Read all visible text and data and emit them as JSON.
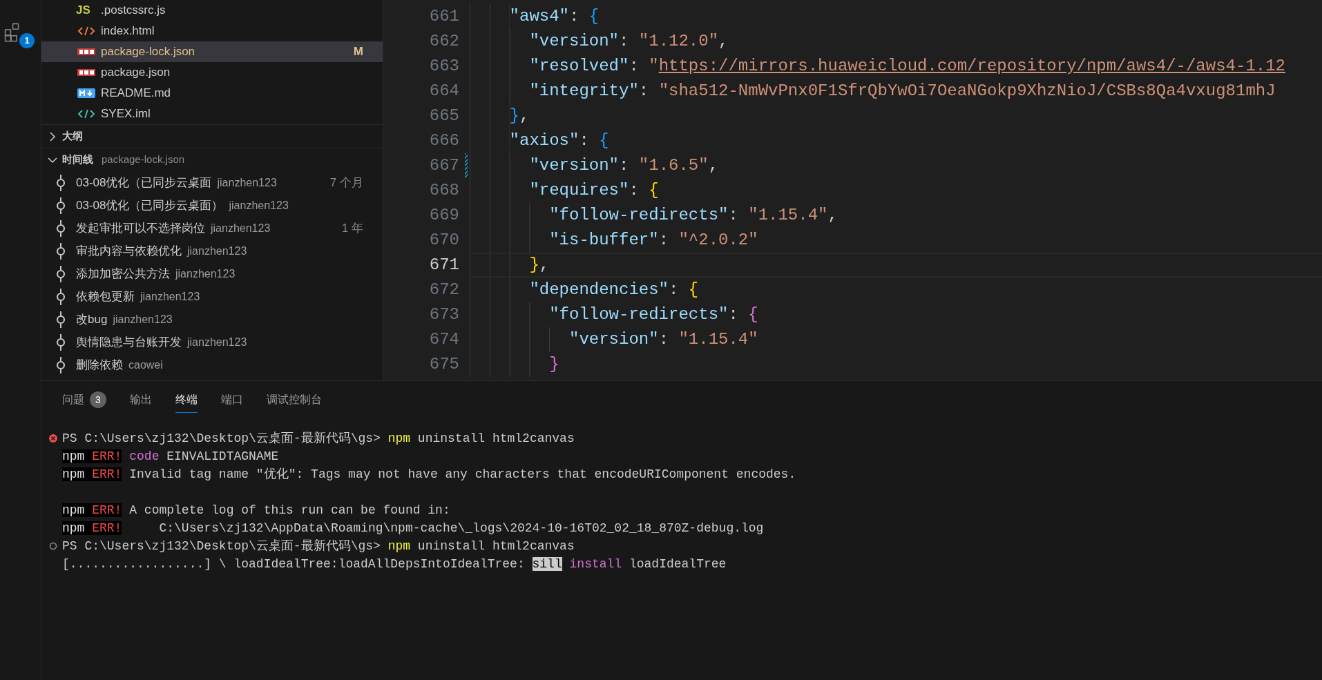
{
  "activity_bar": {
    "extensions_badge": "1"
  },
  "explorer": {
    "files": [
      {
        "name": ".postcssrc.js",
        "kind": "js",
        "icon_text": "JS",
        "selected": false,
        "modified": false
      },
      {
        "name": "index.html",
        "kind": "html",
        "selected": false,
        "modified": false
      },
      {
        "name": "package-lock.json",
        "kind": "npm",
        "selected": true,
        "modified": true,
        "status_letter": "M"
      },
      {
        "name": "package.json",
        "kind": "npm",
        "selected": false,
        "modified": false
      },
      {
        "name": "README.md",
        "kind": "markdown",
        "selected": false,
        "modified": false
      },
      {
        "name": "SYEX.iml",
        "kind": "xml",
        "selected": false,
        "modified": false
      }
    ]
  },
  "outline": {
    "title": "大纲",
    "expanded": false
  },
  "timeline": {
    "title": "时间线",
    "subtitle": "package-lock.json",
    "expanded": true,
    "items": [
      {
        "message": "03-08优化（已同步云桌面",
        "author": "jianzhen123",
        "time": "7 个月"
      },
      {
        "message": "03-08优化（已同步云桌面）",
        "author": "jianzhen123"
      },
      {
        "message": "发起审批可以不选择岗位",
        "author": "jianzhen123",
        "time": "1 年"
      },
      {
        "message": "审批内容与依赖优化",
        "author": "jianzhen123"
      },
      {
        "message": "添加加密公共方法",
        "author": "jianzhen123"
      },
      {
        "message": "依赖包更新",
        "author": "jianzhen123"
      },
      {
        "message": "改bug",
        "author": "jianzhen123"
      },
      {
        "message": "舆情隐患与台账开发",
        "author": "jianzhen123"
      },
      {
        "message": "删除依赖",
        "author": "caowei"
      }
    ]
  },
  "editor": {
    "lines": [
      {
        "number": "661",
        "current": false,
        "modified": false,
        "tokens": [
          {
            "text": "\"aws4\"",
            "kind": "key"
          },
          {
            "text": ": ",
            "kind": "punct"
          },
          {
            "text": "{",
            "kind": "bracket",
            "color": "#179fff"
          }
        ],
        "children": [
          {
            "number": "662",
            "current": false,
            "modified": false,
            "tokens": [
              {
                "text": "\"version\"",
                "kind": "key"
              },
              {
                "text": ": ",
                "kind": "punct"
              },
              {
                "text": "\"1.12.0\"",
                "kind": "string"
              },
              {
                "text": ",",
                "kind": "punct"
              }
            ]
          },
          {
            "number": "663",
            "current": false,
            "modified": false,
            "tokens": [
              {
                "text": "\"resolved\"",
                "kind": "key"
              },
              {
                "text": ": ",
                "kind": "punct"
              },
              {
                "text": "\"",
                "kind": "string"
              },
              {
                "text": "https://mirrors.huaweicloud.com/repository/npm/aws4/-/aws4-1.12",
                "kind": "link"
              }
            ]
          },
          {
            "number": "664",
            "current": false,
            "modified": false,
            "tokens": [
              {
                "text": "\"integrity\"",
                "kind": "key"
              },
              {
                "text": ": ",
                "kind": "punct"
              },
              {
                "text": "\"sha512-NmWvPnx0F1SfrQbYwOi7OeaNGokp9XhzNioJ/CSBs8Qa4vxug81mhJ",
                "kind": "string"
              }
            ]
          }
        ]
      },
      {
        "number": "665",
        "current": false,
        "modified": false,
        "tokens": [
          {
            "text": "}",
            "kind": "bracket",
            "color": "#179fff"
          },
          {
            "text": ",",
            "kind": "punct"
          }
        ]
      },
      {
        "number": "666",
        "current": false,
        "modified": false,
        "tokens": [
          {
            "text": "\"axios\"",
            "kind": "key"
          },
          {
            "text": ": ",
            "kind": "punct"
          },
          {
            "text": "{",
            "kind": "bracket",
            "color": "#179fff"
          }
        ],
        "children": [
          {
            "number": "667",
            "current": false,
            "modified": true,
            "tokens": [
              {
                "text": "\"version\"",
                "kind": "key"
              },
              {
                "text": ": ",
                "kind": "punct"
              },
              {
                "text": "\"1.6.5\"",
                "kind": "string"
              },
              {
                "text": ",",
                "kind": "punct"
              }
            ]
          },
          {
            "number": "668",
            "current": false,
            "modified": false,
            "tokens": [
              {
                "text": "\"requires\"",
                "kind": "key"
              },
              {
                "text": ": ",
                "kind": "punct"
              },
              {
                "text": "{",
                "kind": "bracket",
                "color": "#ffd700"
              }
            ],
            "children": [
              {
                "number": "669",
                "current": false,
                "modified": false,
                "tokens": [
                  {
                    "text": "\"follow-redirects\"",
                    "kind": "key"
                  },
                  {
                    "text": ": ",
                    "kind": "punct"
                  },
                  {
                    "text": "\"1.15.4\"",
                    "kind": "string"
                  },
                  {
                    "text": ",",
                    "kind": "punct"
                  }
                ]
              },
              {
                "number": "670",
                "current": false,
                "modified": false,
                "tokens": [
                  {
                    "text": "\"is-buffer\"",
                    "kind": "key"
                  },
                  {
                    "text": ": ",
                    "kind": "punct"
                  },
                  {
                    "text": "\"^2.0.2\"",
                    "kind": "string"
                  }
                ]
              }
            ]
          },
          {
            "number": "671",
            "current": true,
            "modified": false,
            "tokens": [
              {
                "text": "}",
                "kind": "bracket",
                "color": "#ffd700"
              },
              {
                "text": ",",
                "kind": "punct"
              }
            ]
          },
          {
            "number": "672",
            "current": false,
            "modified": false,
            "tokens": [
              {
                "text": "\"dependencies\"",
                "kind": "key"
              },
              {
                "text": ": ",
                "kind": "punct"
              },
              {
                "text": "{",
                "kind": "bracket",
                "color": "#ffd700"
              }
            ],
            "children": [
              {
                "number": "673",
                "current": false,
                "modified": false,
                "tokens": [
                  {
                    "text": "\"follow-redirects\"",
                    "kind": "key"
                  },
                  {
                    "text": ": ",
                    "kind": "punct"
                  },
                  {
                    "text": "{",
                    "kind": "bracket",
                    "color": "#da70d6"
                  }
                ],
                "children": [
                  {
                    "number": "674",
                    "current": false,
                    "modified": false,
                    "tokens": [
                      {
                        "text": "\"version\"",
                        "kind": "key"
                      },
                      {
                        "text": ": ",
                        "kind": "punct"
                      },
                      {
                        "text": "\"1.15.4\"",
                        "kind": "string"
                      }
                    ]
                  }
                ]
              },
              {
                "number": "675",
                "current": false,
                "modified": false,
                "tokens": [
                  {
                    "text": "}",
                    "kind": "bracket",
                    "color": "#da70d6"
                  }
                ]
              }
            ]
          }
        ]
      }
    ]
  },
  "panel": {
    "tabs": [
      {
        "label": "问题",
        "badge": "3",
        "selected": false
      },
      {
        "label": "输出",
        "selected": false
      },
      {
        "label": "终端",
        "selected": true
      },
      {
        "label": "端口",
        "selected": false
      },
      {
        "label": "调试控制台",
        "selected": false
      }
    ],
    "terminal": {
      "lines": [
        {
          "kind": "failed",
          "tokens": [
            {
              "text": "PS C:\\Users\\zj132\\Desktop\\云桌面-最新代码\\gs> ",
              "kind": "plain"
            },
            {
              "text": "npm",
              "kind": "command"
            },
            {
              "text": " uninstall html2canvas",
              "kind": "plain"
            }
          ]
        },
        {
          "kind": "output",
          "tokens": [
            {
              "text": "npm ",
              "kind": "label"
            },
            {
              "text": "ERR!",
              "kind": "error"
            },
            {
              "text": " code",
              "kind": "keyword"
            },
            {
              "text": " EINVALIDTAGNAME",
              "kind": "plain"
            }
          ]
        },
        {
          "kind": "output",
          "tokens": [
            {
              "text": "npm ",
              "kind": "label"
            },
            {
              "text": "ERR!",
              "kind": "error"
            },
            {
              "text": " Invalid tag name \"优化\": Tags may not have any characters that encodeURIComponent encodes.",
              "kind": "plain"
            }
          ]
        },
        {
          "kind": "blank"
        },
        {
          "kind": "output",
          "tokens": [
            {
              "text": "npm ",
              "kind": "label"
            },
            {
              "text": "ERR!",
              "kind": "error"
            },
            {
              "text": " A complete log of this run can be found in:",
              "kind": "plain"
            }
          ]
        },
        {
          "kind": "output",
          "tokens": [
            {
              "text": "npm ",
              "kind": "label"
            },
            {
              "text": "ERR!",
              "kind": "error"
            },
            {
              "text": "     C:\\Users\\zj132\\AppData\\Roaming\\npm-cache\\_logs\\2024-10-16T02_02_18_870Z-debug.log",
              "kind": "plain"
            }
          ]
        },
        {
          "kind": "running",
          "tokens": [
            {
              "text": "PS C:\\Users\\zj132\\Desktop\\云桌面-最新代码\\gs> ",
              "kind": "plain"
            },
            {
              "text": "npm",
              "kind": "command"
            },
            {
              "text": " uninstall html2canvas",
              "kind": "plain"
            }
          ]
        },
        {
          "kind": "output",
          "tokens": [
            {
              "text": "[..................] \\ loadIdealTree:loadAllDepsIntoIdealTree: ",
              "kind": "plain"
            },
            {
              "text": "sill",
              "kind": "highlight"
            },
            {
              "text": " install",
              "kind": "keyword"
            },
            {
              "text": " loadIdealTree",
              "kind": "plain"
            }
          ]
        }
      ]
    }
  }
}
